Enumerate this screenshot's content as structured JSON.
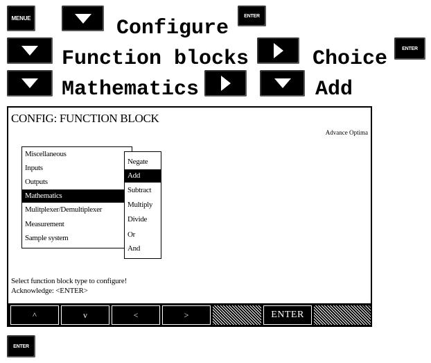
{
  "keys": {
    "menue": "MENUE",
    "enter": "ENTER"
  },
  "instructions": {
    "row1_text": "Configure",
    "row2_text1": "Function blocks",
    "row2_text2": "Choice",
    "row3_text1": "Mathematics",
    "row3_text2": "Add"
  },
  "panel": {
    "title": "CONFIG: FUNCTION BLOCK",
    "subtitle": "Advance Optima",
    "menu_main": [
      "Miscellaneous",
      "Inputs",
      "Outputs",
      "Mathematics",
      "Mulitplexer/Demultiplexer",
      "Measurement",
      "Sample system"
    ],
    "menu_main_selected": "Mathematics",
    "menu_sub": [
      "Negate",
      "Add",
      "Subtract",
      "Multiply",
      "Divide",
      "Or",
      "And"
    ],
    "menu_sub_selected": "Add",
    "status_line1": "Select function block type to configure!",
    "status_line2": "Acknowledge: <ENTER>",
    "softkeys": [
      "^",
      "v",
      "<",
      ">",
      "",
      "ENTER"
    ]
  },
  "icons": {
    "down": "triangle-down-icon",
    "right": "triangle-right-icon"
  }
}
